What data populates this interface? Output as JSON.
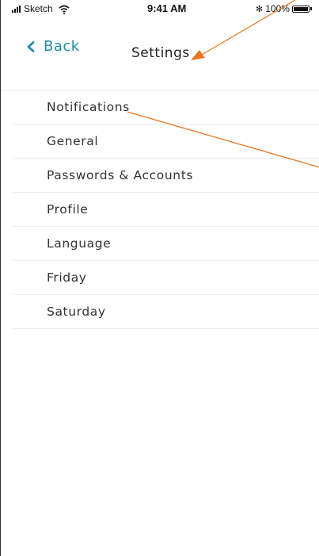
{
  "status_bar": {
    "carrier": "Sketch",
    "time": "9:41 AM",
    "battery": "100%",
    "battery_level": 1.0,
    "icons": [
      "signal-bars-icon",
      "wifi-icon",
      "bluetooth-icon",
      "battery-icon"
    ]
  },
  "nav": {
    "back_label": "Back",
    "title": "Settings",
    "accent_color": "#1f8ba6"
  },
  "settings": {
    "items": [
      {
        "label": "Notifications"
      },
      {
        "label": "General"
      },
      {
        "label": "Passwords & Accounts"
      },
      {
        "label": "Profile"
      },
      {
        "label": "Language"
      },
      {
        "label": "Friday"
      },
      {
        "label": "Saturday"
      }
    ]
  },
  "annotation_color": "#e87722"
}
